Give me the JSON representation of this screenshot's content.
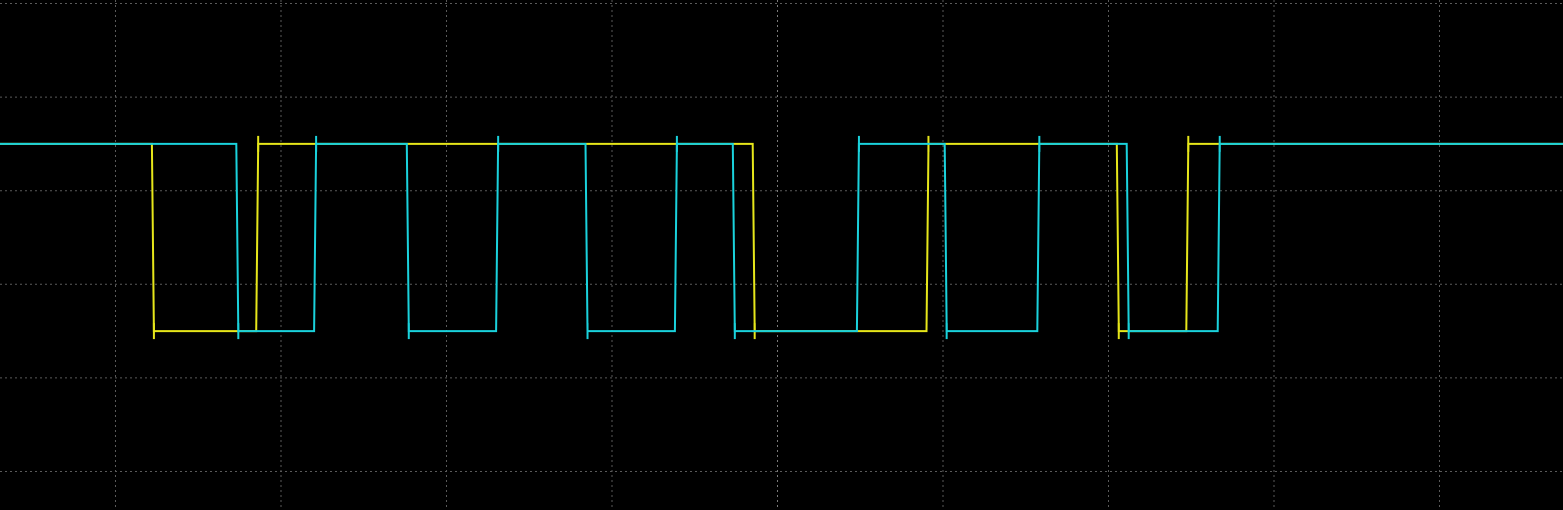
{
  "chart_data": {
    "type": "line",
    "title": "",
    "xlabel": "",
    "ylabel": "",
    "grid": true,
    "grid_divisions": {
      "x": 10,
      "y": 6
    },
    "xlim": [
      0,
      10
    ],
    "ylim": [
      -3.5,
      2.5
    ],
    "high_level": 1,
    "low_level": -1,
    "series": [
      {
        "color": "#e6e61a",
        "transitions": [
          [
            0.0,
            1
          ],
          [
            1.22,
            -1
          ],
          [
            1.85,
            1
          ],
          [
            4.85,
            -1
          ],
          [
            5.9,
            1
          ],
          [
            7.05,
            -1
          ],
          [
            7.47,
            1
          ]
        ],
        "end": 10
      },
      {
        "color": "#1ad2dc",
        "transitions": [
          [
            0.0,
            1
          ],
          [
            1.73,
            -1
          ],
          [
            2.2,
            1
          ],
          [
            2.76,
            -1
          ],
          [
            3.3,
            1
          ],
          [
            3.84,
            -1
          ],
          [
            4.38,
            1
          ],
          [
            4.73,
            -1
          ],
          [
            5.48,
            1
          ],
          [
            6.01,
            -1
          ],
          [
            6.57,
            1
          ],
          [
            7.11,
            -1
          ],
          [
            7.66,
            1
          ]
        ],
        "end": 10
      }
    ]
  }
}
